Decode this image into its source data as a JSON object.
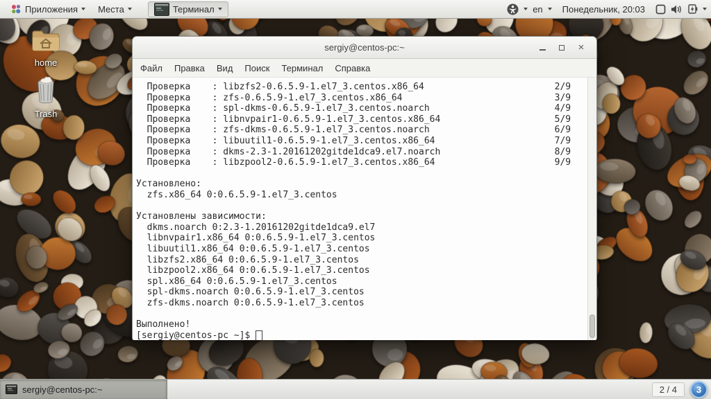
{
  "top_panel": {
    "applications_label": "Приложения",
    "places_label": "Места",
    "active_app_label": "Терминал",
    "keyboard_layout": "en",
    "clock": "Понедельник, 20:03"
  },
  "desktop": {
    "icons": [
      {
        "label": "home"
      },
      {
        "label": "Trash"
      }
    ]
  },
  "terminal": {
    "title": "sergiy@centos-pc:~",
    "menu": [
      "Файл",
      "Правка",
      "Вид",
      "Поиск",
      "Терминал",
      "Справка"
    ],
    "output_lines": [
      "  Проверка    : libzfs2-0.6.5.9-1.el7_3.centos.x86_64                        2/9",
      "  Проверка    : zfs-0.6.5.9-1.el7_3.centos.x86_64                            3/9",
      "  Проверка    : spl-dkms-0.6.5.9-1.el7_3.centos.noarch                       4/9",
      "  Проверка    : libnvpair1-0.6.5.9-1.el7_3.centos.x86_64                     5/9",
      "  Проверка    : zfs-dkms-0.6.5.9-1.el7_3.centos.noarch                       6/9",
      "  Проверка    : libuutil1-0.6.5.9-1.el7_3.centos.x86_64                      7/9",
      "  Проверка    : dkms-2.3-1.20161202gitde1dca9.el7.noarch                     8/9",
      "  Проверка    : libzpool2-0.6.5.9-1.el7_3.centos.x86_64                      9/9",
      "",
      "Установлено:",
      "  zfs.x86_64 0:0.6.5.9-1.el7_3.centos",
      "",
      "Установлены зависимости:",
      "  dkms.noarch 0:2.3-1.20161202gitde1dca9.el7",
      "  libnvpair1.x86_64 0:0.6.5.9-1.el7_3.centos",
      "  libuutil1.x86_64 0:0.6.5.9-1.el7_3.centos",
      "  libzfs2.x86_64 0:0.6.5.9-1.el7_3.centos",
      "  libzpool2.x86_64 0:0.6.5.9-1.el7_3.centos",
      "  spl.x86_64 0:0.6.5.9-1.el7_3.centos",
      "  spl-dkms.noarch 0:0.6.5.9-1.el7_3.centos",
      "  zfs-dkms.noarch 0:0.6.5.9-1.el7_3.centos",
      "",
      "Выполнено!"
    ],
    "prompt": "[sergiy@centos-pc ~]$ "
  },
  "taskbar": {
    "window_button_label": "sergiy@centos-pc:~",
    "workspace_indicator": "2 / 4",
    "badge_count": "3"
  },
  "icons": {
    "close": "×"
  },
  "colors": {
    "badge_blue": "#3c77b8",
    "panel_gray": "#e8e8e5",
    "terminal_bg": "#fdfdfd",
    "terminal_text": "#2b2b2b"
  }
}
